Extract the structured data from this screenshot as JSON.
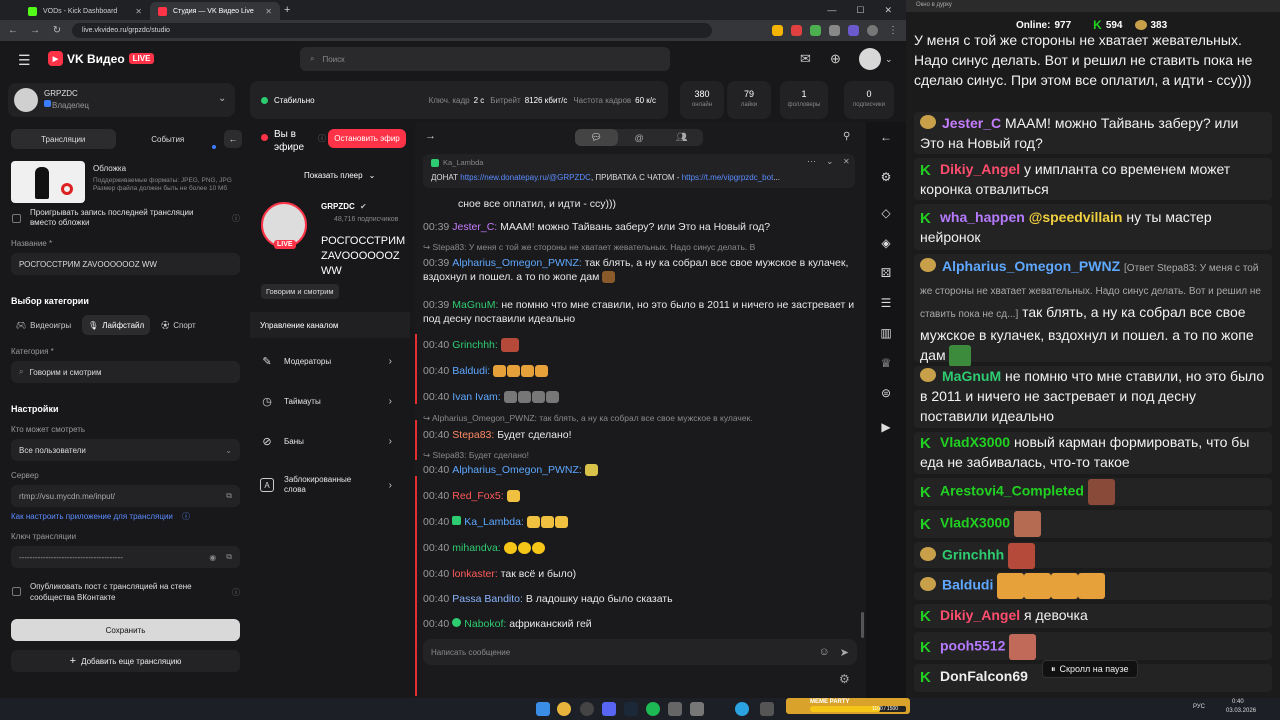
{
  "browser": {
    "tabs": [
      {
        "title": "VODs - Kick Dashboard",
        "fav_color": "#53fc18"
      },
      {
        "title": "Студия — VK Видео Live",
        "fav_color": "#ff3347"
      }
    ],
    "url": "live.vkvideo.ru/grpzdc/studio"
  },
  "vk": {
    "logo_text": "VK Видео",
    "live_badge": "LIVE",
    "search_placeholder": "Поиск"
  },
  "left": {
    "channel_name": "GRPZDC",
    "channel_role": "Владелец",
    "tab_streams": "Трансляции",
    "tab_events": "События",
    "cover_title": "Обложка",
    "cover_hint": "Поддерживаемые форматы: JPEG, PNG, JPG Размер файла должен быть не более 10 Мб",
    "play_last_label": "Проигрывать запись последней трансляции вместо обложки",
    "name_label": "Название *",
    "name_value": "РОСГОССТРИМ ZAVOOOOOOZ WW",
    "category_choice_title": "Выбор категории",
    "cat_games": "Видеоигры",
    "cat_lifestyle": "Лайфстайл",
    "cat_sport": "Спорт",
    "category_label": "Категория *",
    "category_value": "Говорим и смотрим",
    "settings_title": "Настройки",
    "who_label": "Кто может смотреть",
    "who_value": "Все пользователи",
    "server_label": "Сервер",
    "server_value": "rtmp://vsu.mycdn.me/input/",
    "howto_link": "Как настроить приложение для трансляции",
    "key_label": "Ключ трансляции",
    "key_value": "---------------------------------------",
    "publish_label": "Опубликовать пост с трансляцией на стене сообщества ВКонтакте",
    "save_label": "Сохранить",
    "add_label": "Добавить еще трансляцию"
  },
  "stats": {
    "state": "Стабильно",
    "keyframe_label": "Ключ. кадр",
    "keyframe_value": "2 с",
    "bitrate_label": "Битрейт",
    "bitrate_value": "8126 кбит/с",
    "fps_label": "Частота кадров",
    "fps_value": "60 к/с",
    "boxes": [
      {
        "value": "380",
        "label": "онлайн"
      },
      {
        "value": "79",
        "label": "лайки"
      },
      {
        "value": "1",
        "label": "фолловеры"
      },
      {
        "value": "0",
        "label": "подписчики"
      }
    ]
  },
  "mid": {
    "on_air": "Вы в эфире",
    "stop_label": "Остановить эфир",
    "show_player": "Показать плеер",
    "channel": "GRPZDC",
    "subscribers": "48,716 подписчиков",
    "live_badge": "LIVE",
    "stream_title": "РОСГОССТРИМ ZAVOOOOOOZ WW",
    "category_tag": "Говорим и смотрим",
    "manage_title": "Управление каналом",
    "menu": [
      "Модераторы",
      "Таймауты",
      "Баны",
      "Заблокированные слова"
    ]
  },
  "chat": {
    "pinned_author": "Ka_Lambda",
    "pinned_text_prefix": "ДОНАТ",
    "pinned_link1": "https://new.donatepay.ru/@GRPZDC",
    "pinned_mid": ", ПРИВАТКА С ЧАТОМ -",
    "pinned_link2": "https://t.me/vipgrpzdc_bot",
    "pinned_suffix": "...",
    "top_cut_line": "сное все оплатил, и идти - ссу)))",
    "messages": [
      {
        "t": "00:39",
        "name": "Jester_C:",
        "color": "#c77dff",
        "text": "МААМ! можно Тайвань заберу? или Это на Новый год?"
      },
      {
        "reply": "Stepa83: У меня с той же стороны не хватает жевательных. Надо синус делать. В"
      },
      {
        "t": "00:39",
        "name": "Alpharius_Omegon_PWNZ:",
        "color": "#5ea8ff",
        "text": "так блять, а ну ка собрал все свое мужское в кулачек, вздохнул и пошел. а то по жопе дам"
      },
      {
        "t": "00:39",
        "name": "MaGnuM:",
        "color": "#2ecc71",
        "text": "не помню что мне ставили, но это было в 2011 и ничего не застревает и под десну поставили идеально"
      },
      {
        "t": "00:40",
        "name": "Grinchhh:",
        "color": "#2ecc71",
        "text": ""
      },
      {
        "t": "00:40",
        "name": "Baldudi:",
        "color": "#5ea8ff",
        "text": ""
      },
      {
        "t": "00:40",
        "name": "Ivan Ivam:",
        "color": "#5ea8ff",
        "text": ""
      },
      {
        "reply": "Alpharius_Omegon_PWNZ: так блять, а ну ка собрал все свое мужское в кулачек."
      },
      {
        "t": "00:40",
        "name": "Stepa83:",
        "color": "#ff8a65",
        "text": "Будет сделано!"
      },
      {
        "reply": "Stepa83: Будет сделано!"
      },
      {
        "t": "00:40",
        "name": "Alpharius_Omegon_PWNZ:",
        "color": "#5ea8ff",
        "text": ""
      },
      {
        "t": "00:40",
        "name": "Red_Fox5:",
        "color": "#ff5a5a",
        "text": ""
      },
      {
        "t": "00:40",
        "name": "Ka_Lambda:",
        "color": "#5ea8ff",
        "text": ""
      },
      {
        "t": "00:40",
        "name": "mihandva:",
        "color": "#2ecc71",
        "text": ""
      },
      {
        "t": "00:40",
        "name": "lonkaster:",
        "color": "#ff5a5a",
        "text": "так всё и было)"
      },
      {
        "t": "00:40",
        "name": "Passa Bandito:",
        "color": "#8ab4ff",
        "text": "В ладошку надо было сказать"
      },
      {
        "t": "00:40",
        "name": "Nabokof:",
        "color": "#2ecc71",
        "text": "африканский гей"
      }
    ],
    "input_placeholder": "Написать сообщение"
  },
  "overlay": {
    "window_title": "Окно в дурку",
    "online_label": "Online:",
    "online_value": "977",
    "kick_count": "594",
    "vk_count": "383",
    "top_text": "У меня с той же стороны не хватает жевательных. Надо синус делать. Вот и решил не ставить пока не сделаю синус. При этом все оплатил, а идти - ссу)))",
    "messages": [
      {
        "name": "Jester_C",
        "color": "#c77dff",
        "badge": "vk",
        "text": "МААМ! можно Тайвань заберу? или Это на Новый год?"
      },
      {
        "name": "Dikiy_Angel",
        "color": "#ff4d6d",
        "badge": "kick",
        "text": "у импланта со временем может коронка отвалиться"
      },
      {
        "name": "wha_happen",
        "color": "#b57bff",
        "badge": "kick",
        "mention": "@speedvillain",
        "text": "ну ты мастер нейронок"
      },
      {
        "name": "Alpharius_Omegon_PWNZ",
        "color": "#5ea8ff",
        "badge": "vk",
        "reply": "[Ответ Stepa83: У меня с той же стороны не хватает жевательных. Надо синус делать. Вот и решил не ставить пока не сд...]",
        "text": "так блять, а ну ка собрал все свое мужское в кулачек, вздохнул и пошел. а то по жопе дам"
      },
      {
        "name": "MaGnuM",
        "color": "#2ecc71",
        "badge": "vk",
        "text": "не помню что мне ставили, но это было в 2011 и ничего не застревает и под десну поставили идеально"
      },
      {
        "name": "VladX3000",
        "color": "#21d121",
        "badge": "kick",
        "text": "новый карман формировать, что бы еда не забивалась, что-то такое"
      },
      {
        "name": "Arestovi4_Completed",
        "color": "#21d121",
        "badge": "kick",
        "text": ""
      },
      {
        "name": "VladX3000",
        "color": "#21d121",
        "badge": "kick",
        "text": ""
      },
      {
        "name": "Grinchhh",
        "color": "#2ecc71",
        "badge": "vk",
        "text": ""
      },
      {
        "name": "Baldudi",
        "color": "#5ea8ff",
        "badge": "vk",
        "text": ""
      },
      {
        "name": "Dikiy_Angel",
        "color": "#ff4d6d",
        "badge": "kick",
        "text": "я девочка"
      },
      {
        "name": "pooh5512",
        "color": "#b57bff",
        "badge": "kick",
        "text": ""
      },
      {
        "name": "DonFalcon69",
        "color": "#eee",
        "badge": "kick",
        "text": ""
      }
    ],
    "scroll_paused": "Скролл на паузе"
  },
  "taskbar": {
    "lang": "РУС",
    "time": "0:40",
    "date": "03.03.2026",
    "meme_party": "MEME PARTY",
    "meme_progress": "1100 / 1500"
  }
}
